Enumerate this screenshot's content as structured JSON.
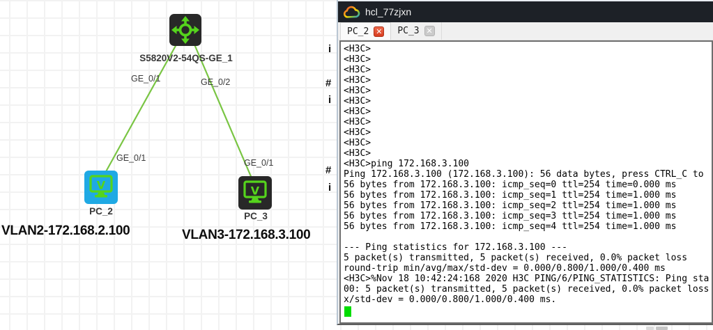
{
  "canvas": {
    "switch": {
      "label": "S5820V2-54QS-GE_1"
    },
    "pc2": {
      "label": "PC_2",
      "caption": "VLAN2-172.168.2.100"
    },
    "pc3": {
      "label": "PC_3",
      "caption": "VLAN3-172.168.3.100"
    },
    "links": [
      {
        "from": "S5820V2-54QS-GE_1",
        "to": "PC_2",
        "switch_end_label": "GE_0/1",
        "device_end_label": "GE_0/1"
      },
      {
        "from": "S5820V2-54QS-GE_1",
        "to": "PC_3",
        "switch_end_label": "GE_0/2",
        "device_end_label": "GE_0/1"
      }
    ],
    "edge_artifacts": [
      "i",
      "#",
      "i",
      "#",
      "i"
    ],
    "colors": {
      "link_green": "#79c543",
      "icon_green": "#55d41c",
      "pc2_blue": "#1fa9e4",
      "node_dark": "#282828",
      "grid_line": "#f2f2f2"
    }
  },
  "window": {
    "title": "hcl_77zjxn",
    "tabs": [
      {
        "label": "PC_2",
        "active": true
      },
      {
        "label": "PC_3",
        "active": false
      }
    ],
    "terminal_lines": [
      "<H3C>",
      "<H3C>",
      "<H3C>",
      "<H3C>",
      "<H3C>",
      "<H3C>",
      "<H3C>",
      "<H3C>",
      "<H3C>",
      "<H3C>",
      "<H3C>",
      "<H3C>ping 172.168.3.100",
      "Ping 172.168.3.100 (172.168.3.100): 56 data bytes, press CTRL_C to",
      "56 bytes from 172.168.3.100: icmp_seq=0 ttl=254 time=0.000 ms",
      "56 bytes from 172.168.3.100: icmp_seq=1 ttl=254 time=1.000 ms",
      "56 bytes from 172.168.3.100: icmp_seq=2 ttl=254 time=1.000 ms",
      "56 bytes from 172.168.3.100: icmp_seq=3 ttl=254 time=1.000 ms",
      "56 bytes from 172.168.3.100: icmp_seq=4 ttl=254 time=1.000 ms",
      "",
      "--- Ping statistics for 172.168.3.100 ---",
      "5 packet(s) transmitted, 5 packet(s) received, 0.0% packet loss",
      "round-trip min/avg/max/std-dev = 0.000/0.800/1.000/0.400 ms",
      "<H3C>%Nov 18 10:42:24:168 2020 H3C PING/6/PING_STATISTICS: Ping sta",
      "00: 5 packet(s) transmitted, 5 packet(s) received, 0.0% packet loss",
      "x/std-dev = 0.000/0.800/1.000/0.400 ms."
    ],
    "colors": {
      "titlebar_bg": "#1d2127",
      "close_active": "#d73d20",
      "close_inactive": "#cbcbcb",
      "cursor_green": "#00dc00"
    }
  }
}
